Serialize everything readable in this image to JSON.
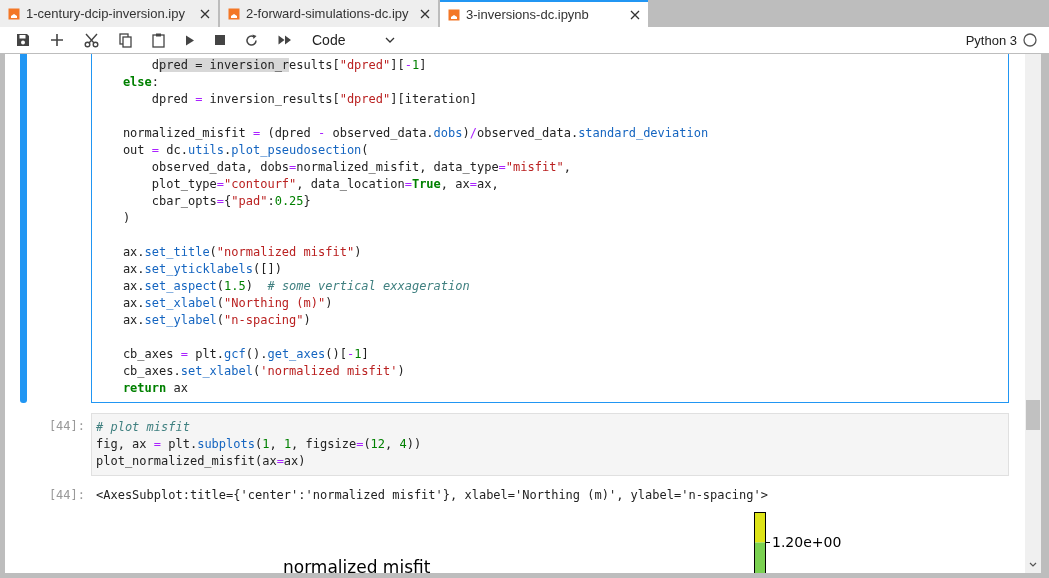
{
  "tabs": [
    {
      "label": "1-century-dcip-inversion.ipy",
      "selected": false
    },
    {
      "label": "2-forward-simulations-dc.ipy",
      "selected": false
    },
    {
      "label": "3-inversions-dc.ipynb",
      "selected": true
    }
  ],
  "toolbar": {
    "cell_type": "Code",
    "kernel": {
      "name": "Python 3",
      "busy": false
    }
  },
  "cells": [
    {
      "kind": "code",
      "active": true,
      "blocks": [
        [
          [
            {
              "kind": "p",
              "text": "        d"
            },
            {
              "kind": "hl",
              "text": "pred = inversion_r"
            },
            {
              "kind": "p",
              "text": "esults["
            },
            {
              "kind": "s",
              "text": "\"dpred\""
            },
            {
              "kind": "p",
              "text": "]["
            },
            {
              "kind": "o",
              "text": "-"
            },
            {
              "kind": "n",
              "text": "1"
            },
            {
              "kind": "p",
              "text": "]"
            }
          ],
          [
            {
              "kind": "k",
              "text": "    else"
            },
            {
              "kind": "p",
              "text": ":"
            }
          ],
          [
            {
              "kind": "p",
              "text": "        dpred "
            },
            {
              "kind": "o",
              "text": "="
            },
            {
              "kind": "p",
              "text": " inversion_results["
            },
            {
              "kind": "s",
              "text": "\"dpred\""
            },
            {
              "kind": "p",
              "text": "][iteration]"
            }
          ]
        ],
        [
          [
            {
              "kind": "p",
              "text": "    normalized_misfit "
            },
            {
              "kind": "o",
              "text": "="
            },
            {
              "kind": "p",
              "text": " (dpred "
            },
            {
              "kind": "o",
              "text": "-"
            },
            {
              "kind": "p",
              "text": " observed_data."
            },
            {
              "kind": "f",
              "text": "dobs"
            },
            {
              "kind": "p",
              "text": ")"
            },
            {
              "kind": "o",
              "text": "/"
            },
            {
              "kind": "p",
              "text": "observed_data."
            },
            {
              "kind": "f",
              "text": "standard_deviation"
            }
          ],
          [
            {
              "kind": "p",
              "text": "    out "
            },
            {
              "kind": "o",
              "text": "="
            },
            {
              "kind": "p",
              "text": " dc."
            },
            {
              "kind": "f",
              "text": "utils"
            },
            {
              "kind": "p",
              "text": "."
            },
            {
              "kind": "f",
              "text": "plot_pseudosection"
            },
            {
              "kind": "p",
              "text": "("
            }
          ],
          [
            {
              "kind": "p",
              "text": "        observed_data, dobs"
            },
            {
              "kind": "o",
              "text": "="
            },
            {
              "kind": "p",
              "text": "normalized_misfit, data_type"
            },
            {
              "kind": "o",
              "text": "="
            },
            {
              "kind": "s",
              "text": "\"misfit\""
            },
            {
              "kind": "p",
              "text": ","
            }
          ],
          [
            {
              "kind": "p",
              "text": "        plot_type"
            },
            {
              "kind": "o",
              "text": "="
            },
            {
              "kind": "s",
              "text": "\"contourf\""
            },
            {
              "kind": "p",
              "text": ", data_location"
            },
            {
              "kind": "o",
              "text": "="
            },
            {
              "kind": "k",
              "text": "True"
            },
            {
              "kind": "p",
              "text": ", ax"
            },
            {
              "kind": "o",
              "text": "="
            },
            {
              "kind": "p",
              "text": "ax,"
            }
          ],
          [
            {
              "kind": "p",
              "text": "        cbar_opts"
            },
            {
              "kind": "o",
              "text": "="
            },
            {
              "kind": "p",
              "text": "{"
            },
            {
              "kind": "s",
              "text": "\"pad\""
            },
            {
              "kind": "p",
              "text": ":"
            },
            {
              "kind": "n",
              "text": "0.25"
            },
            {
              "kind": "p",
              "text": "}"
            }
          ],
          [
            {
              "kind": "p",
              "text": "    )"
            }
          ]
        ],
        [
          [
            {
              "kind": "p",
              "text": "    ax."
            },
            {
              "kind": "f",
              "text": "set_title"
            },
            {
              "kind": "p",
              "text": "("
            },
            {
              "kind": "s",
              "text": "\"normalized misfit\""
            },
            {
              "kind": "p",
              "text": ")"
            }
          ],
          [
            {
              "kind": "p",
              "text": "    ax."
            },
            {
              "kind": "f",
              "text": "set_yticklabels"
            },
            {
              "kind": "p",
              "text": "([])"
            }
          ],
          [
            {
              "kind": "p",
              "text": "    ax."
            },
            {
              "kind": "f",
              "text": "set_aspect"
            },
            {
              "kind": "p",
              "text": "("
            },
            {
              "kind": "n",
              "text": "1.5"
            },
            {
              "kind": "p",
              "text": ")  "
            },
            {
              "kind": "c",
              "text": "# some vertical exxageration"
            }
          ],
          [
            {
              "kind": "p",
              "text": "    ax."
            },
            {
              "kind": "f",
              "text": "set_xlabel"
            },
            {
              "kind": "p",
              "text": "("
            },
            {
              "kind": "s",
              "text": "\"Northing (m)\""
            },
            {
              "kind": "p",
              "text": ")"
            }
          ],
          [
            {
              "kind": "p",
              "text": "    ax."
            },
            {
              "kind": "f",
              "text": "set_ylabel"
            },
            {
              "kind": "p",
              "text": "("
            },
            {
              "kind": "s",
              "text": "\"n-spacing\""
            },
            {
              "kind": "p",
              "text": ")"
            }
          ]
        ],
        [
          [
            {
              "kind": "p",
              "text": "    cb_axes "
            },
            {
              "kind": "o",
              "text": "="
            },
            {
              "kind": "p",
              "text": " plt."
            },
            {
              "kind": "f",
              "text": "gcf"
            },
            {
              "kind": "p",
              "text": "()."
            },
            {
              "kind": "f",
              "text": "get_axes"
            },
            {
              "kind": "p",
              "text": "()["
            },
            {
              "kind": "o",
              "text": "-"
            },
            {
              "kind": "n",
              "text": "1"
            },
            {
              "kind": "p",
              "text": "]"
            }
          ],
          [
            {
              "kind": "p",
              "text": "    cb_axes."
            },
            {
              "kind": "f",
              "text": "set_xlabel"
            },
            {
              "kind": "p",
              "text": "("
            },
            {
              "kind": "s",
              "text": "'normalized misfit'"
            },
            {
              "kind": "p",
              "text": ")"
            }
          ],
          [
            {
              "kind": "k",
              "text": "    return"
            },
            {
              "kind": "p",
              "text": " ax"
            }
          ]
        ]
      ]
    },
    {
      "kind": "code",
      "active": false,
      "prompt": "[44]:",
      "blocks": [
        [
          [
            {
              "kind": "c",
              "text": "# plot misfit"
            }
          ],
          [
            {
              "kind": "p",
              "text": "fig, ax "
            },
            {
              "kind": "o",
              "text": "="
            },
            {
              "kind": "p",
              "text": " plt."
            },
            {
              "kind": "f",
              "text": "subplots"
            },
            {
              "kind": "p",
              "text": "("
            },
            {
              "kind": "n",
              "text": "1"
            },
            {
              "kind": "p",
              "text": ", "
            },
            {
              "kind": "n",
              "text": "1"
            },
            {
              "kind": "p",
              "text": ", figsize"
            },
            {
              "kind": "o",
              "text": "="
            },
            {
              "kind": "p",
              "text": "("
            },
            {
              "kind": "n",
              "text": "12"
            },
            {
              "kind": "p",
              "text": ", "
            },
            {
              "kind": "n",
              "text": "4"
            },
            {
              "kind": "p",
              "text": "))"
            }
          ],
          [
            {
              "kind": "p",
              "text": "plot_normalized_misfit(ax"
            },
            {
              "kind": "o",
              "text": "="
            },
            {
              "kind": "p",
              "text": "ax)"
            }
          ]
        ]
      ]
    },
    {
      "kind": "output",
      "prompt": "[44]:",
      "text": "<AxesSubplot:title={'center':'normalized misfit'}, xlabel='Northing (m)', ylabel='n-spacing'>"
    },
    {
      "kind": "plot",
      "title": "normalized misfit",
      "colorbar_ticks": [
        "1.20e+00"
      ]
    }
  ]
}
